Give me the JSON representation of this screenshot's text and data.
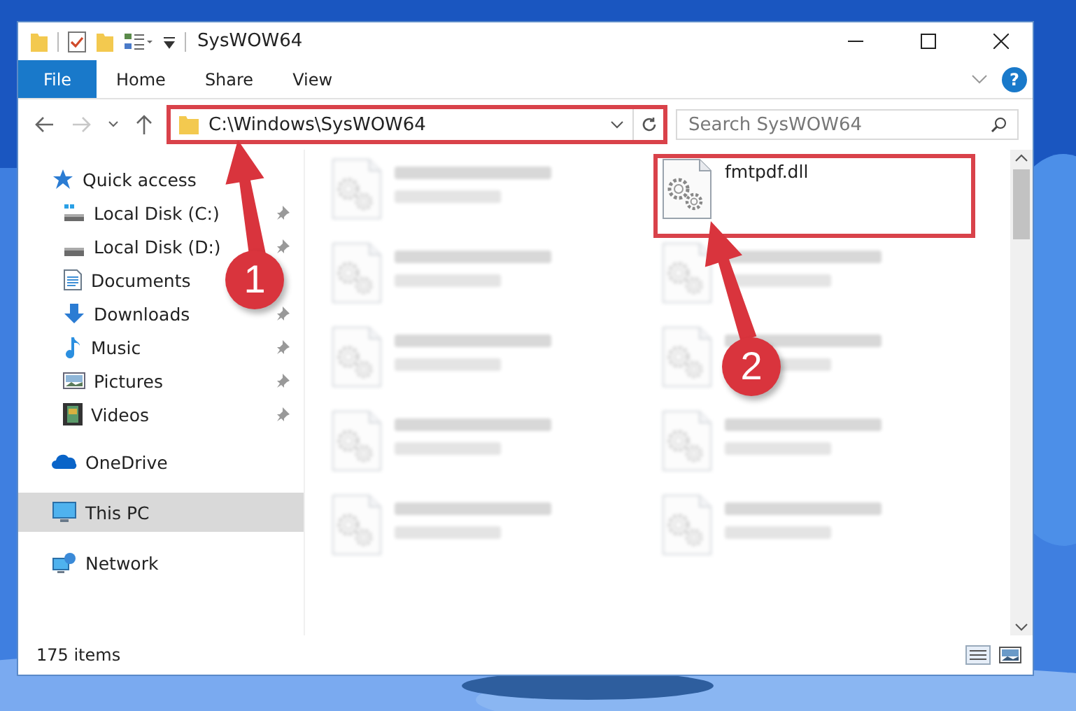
{
  "window": {
    "title": "SysWOW64"
  },
  "ribbon": {
    "tabs": [
      {
        "label": "File",
        "selected": true
      },
      {
        "label": "Home",
        "selected": false
      },
      {
        "label": "Share",
        "selected": false
      },
      {
        "label": "View",
        "selected": false
      }
    ],
    "help": "?"
  },
  "address_bar": {
    "path": "C:\\Windows\\SysWOW64",
    "highlighted": true
  },
  "search": {
    "placeholder": "Search SysWOW64"
  },
  "sidebar": {
    "items": [
      {
        "label": "Quick access",
        "kind": "star",
        "selected": false,
        "children": [
          {
            "label": "Local Disk (C:)",
            "kind": "system-drive",
            "pinned": true,
            "selected": false
          },
          {
            "label": "Local Disk (D:)",
            "kind": "drive",
            "pinned": true,
            "selected": false
          },
          {
            "label": "Documents",
            "kind": "documents",
            "pinned": false,
            "selected": false
          },
          {
            "label": "Downloads",
            "kind": "downloads",
            "pinned": true,
            "selected": false
          },
          {
            "label": "Music",
            "kind": "music",
            "pinned": true,
            "selected": false
          },
          {
            "label": "Pictures",
            "kind": "pictures",
            "pinned": true,
            "selected": false
          },
          {
            "label": "Videos",
            "kind": "videos",
            "pinned": true,
            "selected": false
          }
        ]
      },
      {
        "label": "OneDrive",
        "kind": "cloud",
        "selected": false
      },
      {
        "label": "This PC",
        "kind": "computer",
        "selected": true
      },
      {
        "label": "Network",
        "kind": "network",
        "selected": false
      }
    ]
  },
  "files": [
    {
      "kind": "blurred"
    },
    {
      "kind": "file",
      "name": "fmtpdf.dll",
      "highlighted": true
    },
    {
      "kind": "blurred"
    },
    {
      "kind": "blurred"
    },
    {
      "kind": "blurred"
    },
    {
      "kind": "blurred"
    },
    {
      "kind": "blurred"
    },
    {
      "kind": "blurred"
    },
    {
      "kind": "blurred"
    },
    {
      "kind": "blurred"
    }
  ],
  "status_bar": {
    "item_count": "175 items"
  },
  "annotations": [
    {
      "label": "1"
    },
    {
      "label": "2"
    }
  ]
}
